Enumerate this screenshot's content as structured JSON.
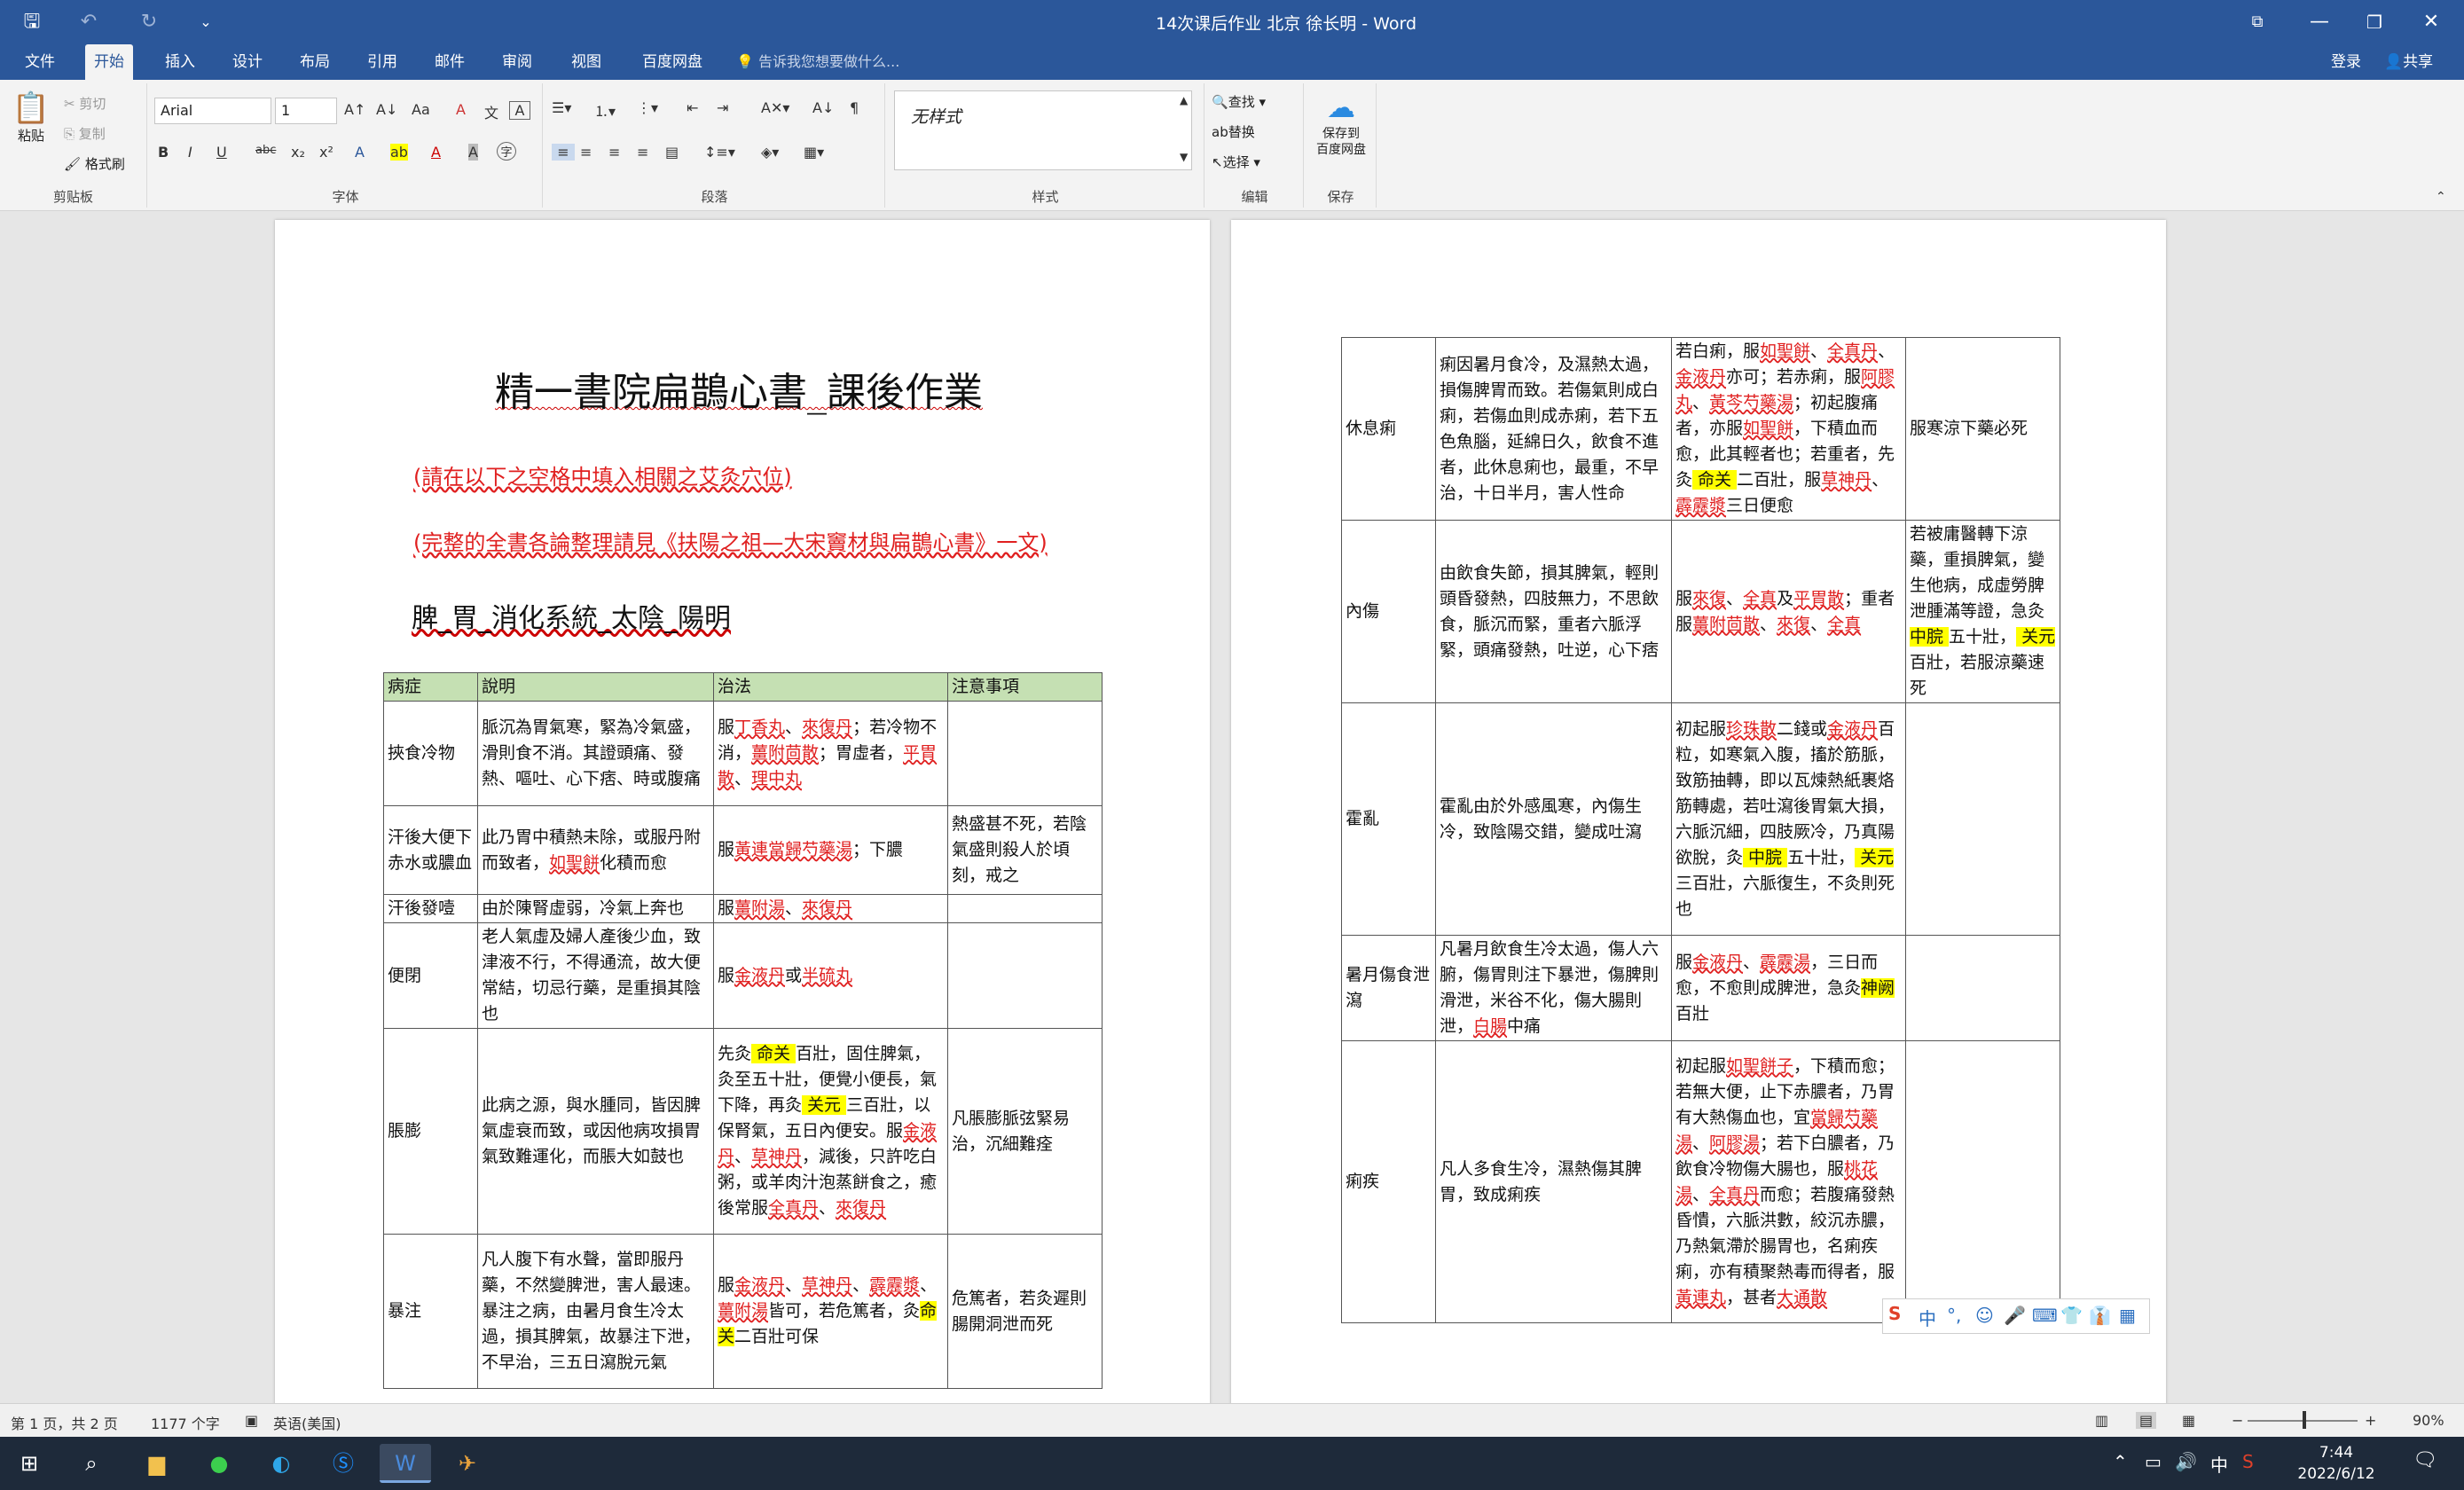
{
  "window": {
    "title": "14次课后作业 北京 徐长明 - Word",
    "icons": {
      "save": "save-icon",
      "undo": "undo-icon",
      "redo": "redo-icon",
      "customize": "customize-quick-access-icon",
      "ribbon_display": "ribbon-display-options-icon",
      "minimize": "minimize-icon",
      "restore": "restore-icon",
      "close": "close-icon"
    }
  },
  "menu": {
    "tabs": [
      "文件",
      "开始",
      "插入",
      "设计",
      "布局",
      "引用",
      "邮件",
      "审阅",
      "视图",
      "百度网盘"
    ],
    "active_tab": "开始",
    "tell_me": "告诉我您想要做什么...",
    "login": "登录",
    "share": "共享"
  },
  "ribbon": {
    "clipboard": {
      "paste": "粘贴",
      "cut": "剪切",
      "copy": "复制",
      "format_painter": "格式刷",
      "label": "剪贴板"
    },
    "font": {
      "font_name": "Arial",
      "font_size": "1",
      "label": "字体",
      "buttons": [
        "A↑",
        "A↓",
        "Aa",
        "A",
        "B",
        "I",
        "U",
        "abc",
        "x₂",
        "x²",
        "A",
        "ab",
        "A",
        "A",
        "字"
      ]
    },
    "paragraph": {
      "label": "段落"
    },
    "styles": {
      "current": "无样式",
      "label": "样式"
    },
    "editing": {
      "find": "查找",
      "replace": "替换",
      "select": "选择",
      "label": "编辑"
    },
    "save": {
      "button_line1": "保存到",
      "button_line2": "百度网盘",
      "label": "保存"
    }
  },
  "page1": {
    "title": "精一書院扁鵲心書_課後作業",
    "note1": "(請在以下之空格中填入相關之艾灸穴位)",
    "note2": "(完整的全書各論整理請見《扶陽之祖—大宋竇材與扁鵲心書》一文)",
    "subtitle": "脾_胃_消化系統_太陰_陽明",
    "table": {
      "headers": [
        "病症",
        "說明",
        "治法",
        "注意事項"
      ],
      "rows": [
        {
          "cells": [
            [
              "挾食冷物"
            ],
            [
              "脈沉為胃氣寒，緊為冷氣盛，滑則食不消。其證頭痛、發熱、嘔吐、心下痞、時或腹痛"
            ],
            [
              {
                "t": "服",
                "c": ""
              },
              {
                "t": "丁香丸",
                "c": "r"
              },
              {
                "t": "、",
                "c": ""
              },
              {
                "t": "來復丹",
                "c": "r"
              },
              {
                "t": "；若冷物不消，",
                "c": ""
              },
              {
                "t": "薑附茴散",
                "c": "r"
              },
              {
                "t": "；胃虛者，",
                "c": ""
              },
              {
                "t": "平胃散",
                "c": "r"
              },
              {
                "t": "、",
                "c": ""
              },
              {
                "t": "理中丸",
                "c": "r"
              }
            ],
            [
              ""
            ]
          ]
        },
        {
          "cells": [
            [
              "汗後大便下赤水或膿血"
            ],
            [
              {
                "t": "此乃胃中積熱未除，或服丹附而致者，",
                "c": ""
              },
              {
                "t": "如聖餅",
                "c": "r"
              },
              {
                "t": "化積而愈",
                "c": ""
              }
            ],
            [
              {
                "t": "服",
                "c": ""
              },
              {
                "t": "黃連當歸芍藥湯",
                "c": "r"
              },
              {
                "t": "；下膿",
                "c": ""
              }
            ],
            [
              "熱盛甚不死，若陰氣盛則殺人於頃刻，戒之"
            ]
          ]
        },
        {
          "cells": [
            [
              "汗後發噎"
            ],
            [
              "由於陳腎虛弱，冷氣上奔也"
            ],
            [
              {
                "t": "服",
                "c": ""
              },
              {
                "t": "薑附湯",
                "c": "r"
              },
              {
                "t": "、",
                "c": ""
              },
              {
                "t": "來復丹",
                "c": "r"
              }
            ],
            [
              ""
            ]
          ]
        },
        {
          "cells": [
            [
              "便閉"
            ],
            [
              "老人氣虛及婦人產後少血，致津液不行，不得通流，故大便常結，切忌行藥，是重損其陰也"
            ],
            [
              {
                "t": "服",
                "c": ""
              },
              {
                "t": "金液丹",
                "c": "r"
              },
              {
                "t": "或",
                "c": ""
              },
              {
                "t": "半硫丸",
                "c": "r"
              }
            ],
            [
              ""
            ]
          ]
        },
        {
          "cells": [
            [
              "脹膨"
            ],
            [
              "此病之源，與水腫同，皆因脾氣虛衰而致，或因他病攻損胃氣致難運化，而脹大如鼓也"
            ],
            [
              {
                "t": "先灸",
                "c": ""
              },
              {
                "t": " 命关 ",
                "c": "hl"
              },
              {
                "t": "百壯，固住脾氣，灸至五十壯，便覺小便長，氣下降，再灸",
                "c": ""
              },
              {
                "t": " 关元 ",
                "c": "hl"
              },
              {
                "t": "三百壯，以保腎氣，五日內便安。服",
                "c": ""
              },
              {
                "t": "金液丹",
                "c": "r"
              },
              {
                "t": "、",
                "c": ""
              },
              {
                "t": "草神丹",
                "c": "r"
              },
              {
                "t": "，減後，只許吃白粥，或羊肉汁泡蒸餅食之，癒後常服",
                "c": ""
              },
              {
                "t": "全真丹",
                "c": "r"
              },
              {
                "t": "、",
                "c": ""
              },
              {
                "t": "來復丹",
                "c": "r"
              }
            ],
            [
              "凡脹膨脈弦緊易治，沉細難痊"
            ]
          ]
        },
        {
          "cells": [
            [
              "暴注"
            ],
            [
              "凡人腹下有水聲，當即服丹藥，不然變脾泄，害人最速。暴注之病，由暑月食生冷太過，損其脾氣，故暴注下泄，不早治，三五日瀉脫元氣"
            ],
            [
              {
                "t": "服",
                "c": ""
              },
              {
                "t": "金液丹",
                "c": "r"
              },
              {
                "t": "、",
                "c": ""
              },
              {
                "t": "草神丹",
                "c": "r"
              },
              {
                "t": "、",
                "c": ""
              },
              {
                "t": "霹靂漿",
                "c": "r"
              },
              {
                "t": "、",
                "c": ""
              },
              {
                "t": "薑附湯",
                "c": "r"
              },
              {
                "t": "皆可，若危篤者，灸",
                "c": ""
              },
              {
                "t": "命关",
                "c": "hl"
              },
              {
                "t": "二百壯可保",
                "c": ""
              }
            ],
            [
              "危篤者，若灸遲則腸開洞泄而死"
            ]
          ]
        }
      ]
    }
  },
  "page2": {
    "table": {
      "rows": [
        {
          "cells": [
            [
              "休息痢"
            ],
            [
              "痢因暑月食冷，及濕熱太過，損傷脾胃而致。若傷氣則成白痢，若傷血則成赤痢，若下五色魚腦，延綿日久，飲食不進者，此休息痢也，最重，不早治，十日半月，害人性命"
            ],
            [
              {
                "t": "若白痢，服",
                "c": ""
              },
              {
                "t": "如聖餅",
                "c": "r"
              },
              {
                "t": "、",
                "c": ""
              },
              {
                "t": "全真丹",
                "c": "r"
              },
              {
                "t": "、",
                "c": ""
              },
              {
                "t": "金液丹",
                "c": "r"
              },
              {
                "t": "亦可；若赤痢，服",
                "c": ""
              },
              {
                "t": "阿膠丸",
                "c": "r"
              },
              {
                "t": "、",
                "c": ""
              },
              {
                "t": "黃芩芍藥湯",
                "c": "r"
              },
              {
                "t": "；初起腹痛者，亦服",
                "c": ""
              },
              {
                "t": "如聖餅",
                "c": "r"
              },
              {
                "t": "，下積血而愈，此其輕者也；若重者，先灸",
                "c": ""
              },
              {
                "t": " 命关 ",
                "c": "hl"
              },
              {
                "t": "二百壯，服",
                "c": ""
              },
              {
                "t": "草神丹",
                "c": "r"
              },
              {
                "t": "、",
                "c": ""
              },
              {
                "t": "霹靂漿",
                "c": "r"
              },
              {
                "t": "三日便愈",
                "c": ""
              }
            ],
            [
              "服寒涼下藥必死"
            ]
          ]
        },
        {
          "cells": [
            [
              "內傷"
            ],
            [
              "由飲食失節，損其脾氣，輕則頭昏發熱，四肢無力，不思飲食，脈沉而緊，重者六脈浮緊，頭痛發熱，吐逆，心下痞"
            ],
            [
              {
                "t": "服",
                "c": ""
              },
              {
                "t": "來復",
                "c": "r"
              },
              {
                "t": "、",
                "c": ""
              },
              {
                "t": "全真",
                "c": "r"
              },
              {
                "t": "及",
                "c": ""
              },
              {
                "t": "平胃散",
                "c": "r"
              },
              {
                "t": "；重者服",
                "c": ""
              },
              {
                "t": "薑附茴散",
                "c": "r"
              },
              {
                "t": "、",
                "c": ""
              },
              {
                "t": "來復",
                "c": "r"
              },
              {
                "t": "、",
                "c": ""
              },
              {
                "t": "全真",
                "c": "r"
              }
            ],
            [
              {
                "t": "若被庸醫轉下涼藥，重損脾氣，變生他病，成虛勞脾泄腫滿等證，急灸",
                "c": ""
              },
              {
                "t": " 中脘 ",
                "c": "hl"
              },
              {
                "t": "五十壯，",
                "c": ""
              },
              {
                "t": " 关元 ",
                "c": "hl"
              },
              {
                "t": "百壯，若服涼藥速死",
                "c": ""
              }
            ]
          ]
        },
        {
          "cells": [
            [
              "霍亂"
            ],
            [
              "霍亂由於外感風寒，內傷生冷，致陰陽交錯，變成吐瀉"
            ],
            [
              {
                "t": "初起服",
                "c": ""
              },
              {
                "t": "珍珠散",
                "c": "r"
              },
              {
                "t": "二錢或",
                "c": ""
              },
              {
                "t": "金液丹",
                "c": "r"
              },
              {
                "t": "百粒，如寒氣入腹，搐於筋脈，致筋抽轉，即以瓦煉熱紙裹烙筋轉處，若吐瀉後胃氣大損，六脈沉細，四肢厥冷，乃真陽欲脫，灸",
                "c": ""
              },
              {
                "t": " 中脘 ",
                "c": "hl"
              },
              {
                "t": "五十壯，",
                "c": ""
              },
              {
                "t": " 关元 ",
                "c": "hl"
              },
              {
                "t": "三百壯，六脈復生，不灸則死也",
                "c": ""
              }
            ],
            [
              ""
            ]
          ]
        },
        {
          "cells": [
            [
              "暑月傷食泄瀉"
            ],
            [
              {
                "t": "凡暑月飲食生冷太過，傷人六腑，傷胃則注下暴泄，傷脾則滑泄，米谷不化，傷大腸則泄，",
                "c": ""
              },
              {
                "t": "白腸",
                "c": "r"
              },
              {
                "t": "中痛",
                "c": ""
              }
            ],
            [
              {
                "t": "服",
                "c": ""
              },
              {
                "t": "金液丹",
                "c": "r"
              },
              {
                "t": "、",
                "c": ""
              },
              {
                "t": "霹靂湯",
                "c": "r"
              },
              {
                "t": "，三日而愈，不愈則成脾泄，急灸",
                "c": ""
              },
              {
                "t": "神阙",
                "c": "hl"
              },
              {
                "t": "百壯",
                "c": ""
              }
            ],
            [
              ""
            ]
          ]
        },
        {
          "cells": [
            [
              "痢疾"
            ],
            [
              "凡人多食生冷，濕熱傷其脾胃，致成痢疾"
            ],
            [
              {
                "t": "初起服",
                "c": ""
              },
              {
                "t": "如聖餅子",
                "c": "r"
              },
              {
                "t": "，下積而愈；若無大便，止下赤膿者，乃胃有大熱傷血也，宜",
                "c": ""
              },
              {
                "t": "當歸芍藥湯",
                "c": "r"
              },
              {
                "t": "、",
                "c": ""
              },
              {
                "t": "阿膠湯",
                "c": "r"
              },
              {
                "t": "；若下白膿者，乃飲食冷物傷大腸也，服",
                "c": ""
              },
              {
                "t": "桃花湯",
                "c": "r"
              },
              {
                "t": "、",
                "c": ""
              },
              {
                "t": "全真丹",
                "c": "r"
              },
              {
                "t": "而愈；若腹痛發熱昏憒，六脈洪數，絞沉赤膿，乃熱氣滯於腸胃也，名痢疾痢，亦有積聚熱毒而得者，服",
                "c": ""
              },
              {
                "t": "黃連丸",
                "c": "r"
              },
              {
                "t": "，甚者",
                "c": ""
              },
              {
                "t": "大通散",
                "c": "r"
              }
            ],
            [
              ""
            ]
          ]
        }
      ]
    }
  },
  "status": {
    "page": "第 1 页，共 2 页",
    "words": "1177 个字",
    "language": "英语(美国)",
    "zoom": "90%"
  },
  "taskbar": {
    "time": "7:44",
    "date": "2022/6/12",
    "ime_lang": "中"
  },
  "ime_bar": {
    "items": [
      "S",
      "中",
      "°,",
      "☺",
      "🎤",
      "⌨",
      "👕",
      "👔",
      "▦"
    ]
  }
}
